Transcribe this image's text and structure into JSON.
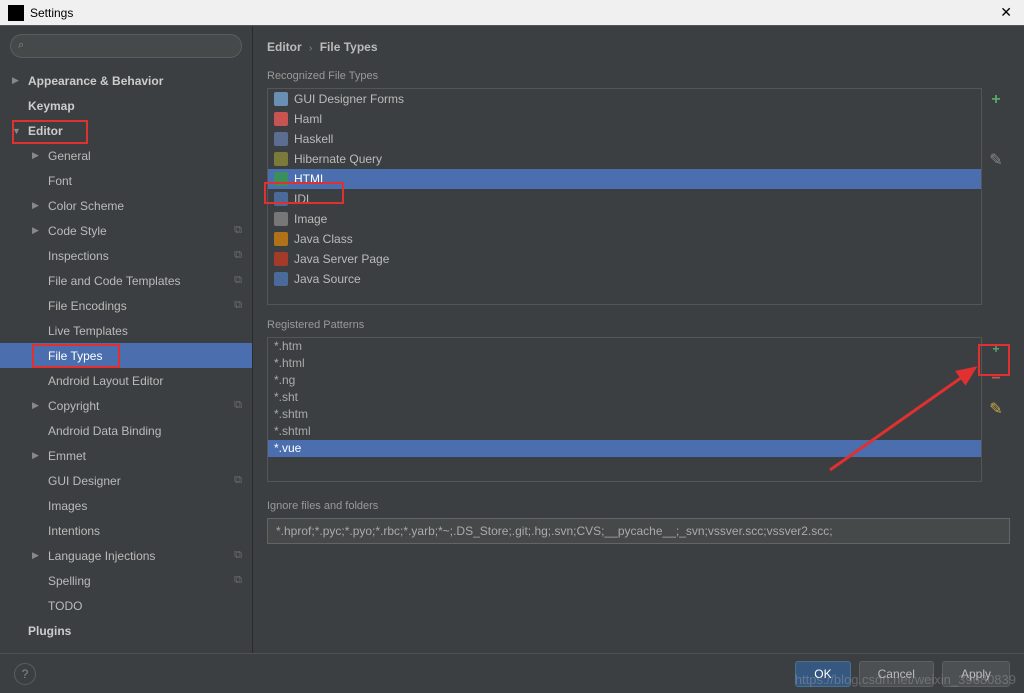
{
  "window": {
    "title": "Settings",
    "close": "✕"
  },
  "search": {
    "placeholder": ""
  },
  "tree": [
    {
      "label": "Appearance & Behavior",
      "depth": 0,
      "arrow": "▶",
      "bold": true
    },
    {
      "label": "Keymap",
      "depth": 0,
      "bold": true
    },
    {
      "label": "Editor",
      "depth": 0,
      "arrow": "▼",
      "bold": true,
      "red": true
    },
    {
      "label": "General",
      "depth": 1,
      "arrow": "▶"
    },
    {
      "label": "Font",
      "depth": 1
    },
    {
      "label": "Color Scheme",
      "depth": 1,
      "arrow": "▶"
    },
    {
      "label": "Code Style",
      "depth": 1,
      "arrow": "▶",
      "cfg": true
    },
    {
      "label": "Inspections",
      "depth": 1,
      "cfg": true
    },
    {
      "label": "File and Code Templates",
      "depth": 1,
      "cfg": true
    },
    {
      "label": "File Encodings",
      "depth": 1,
      "cfg": true
    },
    {
      "label": "Live Templates",
      "depth": 1
    },
    {
      "label": "File Types",
      "depth": 1,
      "selected": true,
      "red": true
    },
    {
      "label": "Android Layout Editor",
      "depth": 1
    },
    {
      "label": "Copyright",
      "depth": 1,
      "arrow": "▶",
      "cfg": true
    },
    {
      "label": "Android Data Binding",
      "depth": 1
    },
    {
      "label": "Emmet",
      "depth": 1,
      "arrow": "▶"
    },
    {
      "label": "GUI Designer",
      "depth": 1,
      "cfg": true
    },
    {
      "label": "Images",
      "depth": 1
    },
    {
      "label": "Intentions",
      "depth": 1
    },
    {
      "label": "Language Injections",
      "depth": 1,
      "arrow": "▶",
      "cfg": true
    },
    {
      "label": "Spelling",
      "depth": 1,
      "cfg": true
    },
    {
      "label": "TODO",
      "depth": 1
    },
    {
      "label": "Plugins",
      "depth": 0,
      "bold": true
    }
  ],
  "breadcrumb": {
    "a": "Editor",
    "b": "File Types"
  },
  "sections": {
    "recognized": "Recognized File Types",
    "patterns": "Registered Patterns",
    "ignore": "Ignore files and folders"
  },
  "file_types": [
    {
      "label": "GUI Designer Forms",
      "color": "#6a8fb5"
    },
    {
      "label": "Haml",
      "color": "#c75450"
    },
    {
      "label": "Haskell",
      "color": "#5b6e91"
    },
    {
      "label": "Hibernate Query",
      "color": "#7a7a3a"
    },
    {
      "label": "HTML",
      "color": "#3a8f5d",
      "selected": true,
      "red": true
    },
    {
      "label": "IDL",
      "color": "#4a6a9a"
    },
    {
      "label": "Image",
      "color": "#777"
    },
    {
      "label": "Java Class",
      "color": "#b07219"
    },
    {
      "label": "Java Server Page",
      "color": "#a33a2a"
    },
    {
      "label": "Java Source",
      "color": "#4a6a9a"
    }
  ],
  "patterns": [
    {
      "label": "*.htm"
    },
    {
      "label": "*.html"
    },
    {
      "label": "*.ng"
    },
    {
      "label": "*.sht"
    },
    {
      "label": "*.shtm"
    },
    {
      "label": "*.shtml"
    },
    {
      "label": "*.vue",
      "selected": true
    }
  ],
  "ignore_value": "*.hprof;*.pyc;*.pyo;*.rbc;*.yarb;*~;.DS_Store;.git;.hg;.svn;CVS;__pycache__;_svn;vssver.scc;vssver2.scc;",
  "buttons": {
    "ok": "OK",
    "cancel": "Cancel",
    "apply": "Apply",
    "help": "?"
  },
  "watermark": "https://blog.csdn.net/weixin_39680839"
}
